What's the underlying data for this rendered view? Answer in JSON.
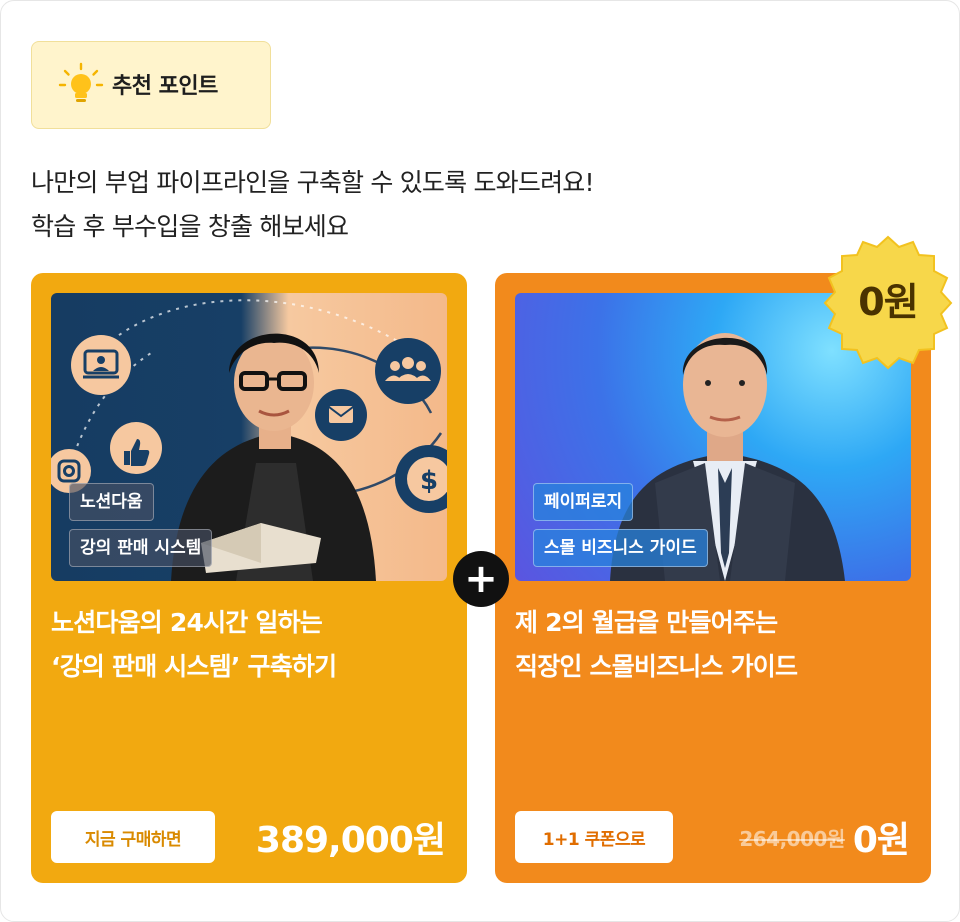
{
  "badge": {
    "icon": "lightbulb-icon",
    "label": "추천 포인트"
  },
  "description": [
    "나만의 부업 파이프라인을 구축할 수 있도록 도와드려요!",
    "학습 후 부수입을 창출 해보세요"
  ],
  "colors": {
    "left_card": "#f2a910",
    "right_card": "#f28a1c",
    "badge_bg": "#fff4cc",
    "seal": "#f7d74a"
  },
  "cards": [
    {
      "tags": [
        "노션다움",
        "강의 판매 시스템"
      ],
      "title_lines": [
        "노션다움의 24시간 일하는",
        "‘강의 판매 시스템’ 구축하기"
      ],
      "cta": "지금 구매하면",
      "price": "389,000원",
      "icons": [
        "video-lesson-icon",
        "thumbs-up-icon",
        "instagram-icon",
        "mail-icon",
        "people-icon",
        "dollar-icon"
      ]
    },
    {
      "tags": [
        "페이퍼로지",
        "스몰 비즈니스 가이드"
      ],
      "title_lines": [
        "제 2의 월급을 만들어주는",
        "직장인 스몰비즈니스 가이드"
      ],
      "cta": "1+1 쿠폰으로",
      "old_price": "264,000원",
      "price": "0원"
    }
  ],
  "plus_symbol": "+",
  "seal_label": "0원"
}
